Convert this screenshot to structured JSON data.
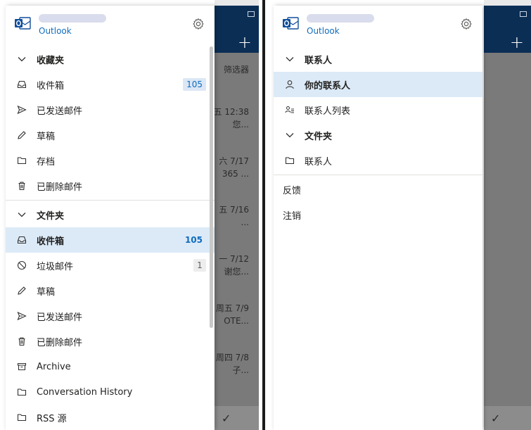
{
  "left": {
    "app_name": "Outlook",
    "favorites": {
      "title": "收藏夹",
      "items": [
        {
          "label": "收件箱",
          "badge": "105"
        },
        {
          "label": "已发送邮件",
          "badge": ""
        },
        {
          "label": "草稿",
          "badge": ""
        },
        {
          "label": "存档",
          "badge": ""
        },
        {
          "label": "已删除邮件",
          "badge": ""
        }
      ]
    },
    "folders": {
      "title": "文件夹",
      "items": [
        {
          "label": "收件箱",
          "badge": "105"
        },
        {
          "label": "垃圾邮件",
          "badge": "1"
        },
        {
          "label": "草稿",
          "badge": ""
        },
        {
          "label": "已发送邮件",
          "badge": ""
        },
        {
          "label": "已删除邮件",
          "badge": ""
        },
        {
          "label": "Archive",
          "badge": ""
        },
        {
          "label": "Conversation History",
          "badge": ""
        },
        {
          "label": "RSS 源",
          "badge": ""
        }
      ]
    },
    "background": {
      "cells": [
        "筛选器",
        "五 12:38",
        "您...",
        "六 7/17",
        "365 ...",
        "五 7/16",
        "...",
        "一 7/12",
        "谢您...",
        "周五 7/9",
        "OTE...",
        "周四 7/8",
        "子..."
      ]
    }
  },
  "right": {
    "app_name": "Outlook",
    "contacts": {
      "title": "联系人",
      "items": [
        {
          "label": "你的联系人"
        },
        {
          "label": "联系人列表"
        }
      ]
    },
    "folders": {
      "title": "文件夹",
      "items": [
        {
          "label": "联系人"
        }
      ]
    },
    "footer": {
      "feedback": "反馈",
      "signout": "注销"
    }
  },
  "colors": {
    "accent": "#0f6cbd",
    "selected_bg": "#dceaf7",
    "header_dark": "#0b2e55"
  }
}
